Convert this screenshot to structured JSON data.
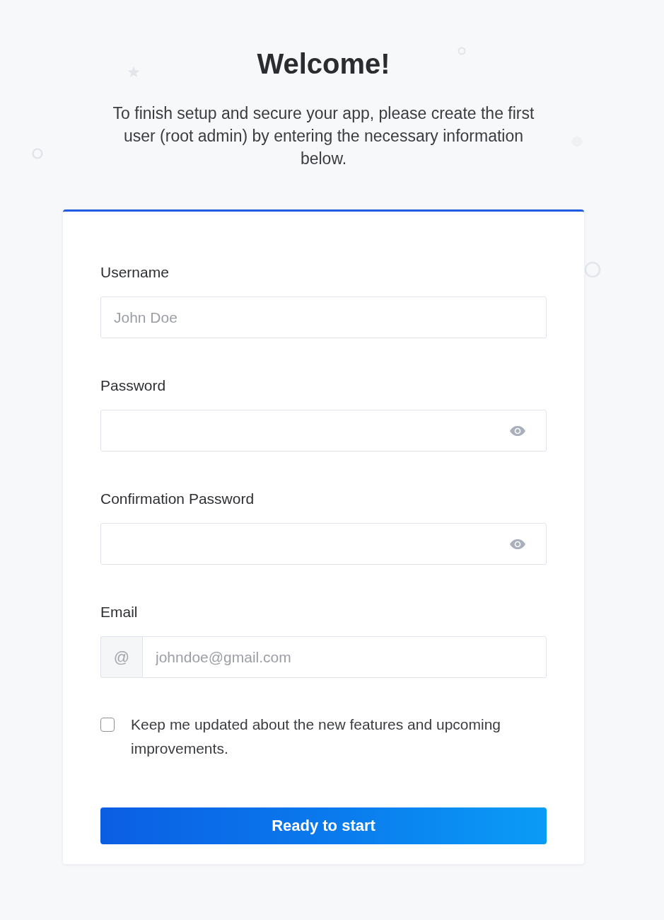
{
  "title": "Welcome!",
  "intro": "To finish setup and secure your app, please create the first user (root admin) by entering the necessary information below.",
  "form": {
    "fields": [
      {
        "kind": "text",
        "label": "Username",
        "placeholder": "John Doe"
      },
      {
        "kind": "password",
        "label": "Password"
      },
      {
        "kind": "password",
        "label": "Confirmation Password"
      },
      {
        "kind": "email",
        "label": "Email",
        "prefix": "@",
        "placeholder": "johndoe@gmail.com"
      }
    ],
    "newsletter": {
      "label": "Keep me updated about the new features and upcoming improvements.",
      "checked": false
    },
    "submit": "Ready to start"
  }
}
